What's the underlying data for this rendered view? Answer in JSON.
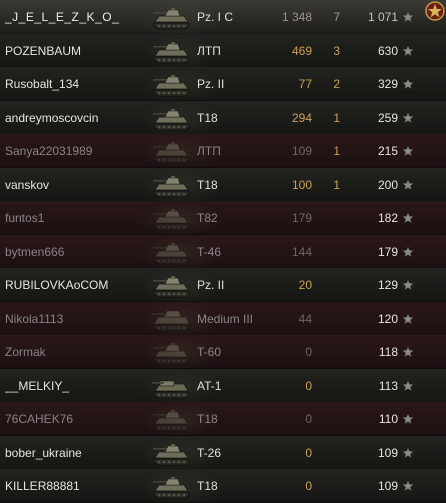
{
  "players": [
    {
      "name": "_J_E_L_E_Z_K_O_",
      "tank_icon": "light-tank-icon",
      "vehicle": "Pz. I C",
      "frags": "1 348",
      "kills": "7",
      "score": "1 071",
      "status": "self"
    },
    {
      "name": "POZENBAUM",
      "tank_icon": "light-tank-icon",
      "vehicle": "ЛТП",
      "frags": "469",
      "kills": "3",
      "score": "630",
      "status": "alive"
    },
    {
      "name": "Rusobalt_134",
      "tank_icon": "light-tank-icon",
      "vehicle": "Pz. II",
      "frags": "77",
      "kills": "2",
      "score": "329",
      "status": "alive"
    },
    {
      "name": "andreymoscovcin",
      "tank_icon": "light-tank-icon",
      "vehicle": "T18",
      "frags": "294",
      "kills": "1",
      "score": "259",
      "status": "alive"
    },
    {
      "name": "Sanya22031989",
      "tank_icon": "light-tank-icon",
      "vehicle": "ЛТП",
      "frags": "109",
      "kills": "1",
      "score": "215",
      "status": "dead"
    },
    {
      "name": "vanskov",
      "tank_icon": "light-tank-icon",
      "vehicle": "T18",
      "frags": "100",
      "kills": "1",
      "score": "200",
      "status": "alive"
    },
    {
      "name": "funtos1",
      "tank_icon": "light-tank-icon",
      "vehicle": "T82",
      "frags": "179",
      "kills": "",
      "score": "182",
      "status": "dead"
    },
    {
      "name": "bytmen666",
      "tank_icon": "light-tank-icon",
      "vehicle": "T-46",
      "frags": "144",
      "kills": "",
      "score": "179",
      "status": "dead"
    },
    {
      "name": "RUBILOVKAoCOM",
      "tank_icon": "light-tank-icon",
      "vehicle": "Pz. II",
      "frags": "20",
      "kills": "",
      "score": "129",
      "status": "alive"
    },
    {
      "name": "Nikola1113",
      "tank_icon": "medium-tank-icon",
      "vehicle": "Medium III",
      "frags": "44",
      "kills": "",
      "score": "120",
      "status": "dead"
    },
    {
      "name": "Zormak",
      "tank_icon": "light-tank-icon",
      "vehicle": "T-60",
      "frags": "0",
      "kills": "",
      "score": "118",
      "status": "dead"
    },
    {
      "name": "__MELKIY_",
      "tank_icon": "at-tank-icon",
      "vehicle": "AT-1",
      "frags": "0",
      "kills": "",
      "score": "113",
      "status": "alive"
    },
    {
      "name": "76CAHEK76",
      "tank_icon": "light-tank-icon",
      "vehicle": "T18",
      "frags": "0",
      "kills": "",
      "score": "110",
      "status": "dead"
    },
    {
      "name": "bober_ukraine",
      "tank_icon": "light-tank-icon",
      "vehicle": "T-26",
      "frags": "0",
      "kills": "",
      "score": "109",
      "status": "alive"
    },
    {
      "name": "KILLER88881",
      "tank_icon": "light-tank-icon",
      "vehicle": "T18",
      "frags": "0",
      "kills": "",
      "score": "109",
      "status": "alive"
    }
  ],
  "star_icon": "star-icon",
  "medal_icon": "medal-icon",
  "colors": {
    "damage": "#cda25a",
    "alive_text": "#e8e6dc",
    "dead_text": "#8a8484",
    "dead_row": "#2c1718",
    "alive_row": "#23231f"
  }
}
